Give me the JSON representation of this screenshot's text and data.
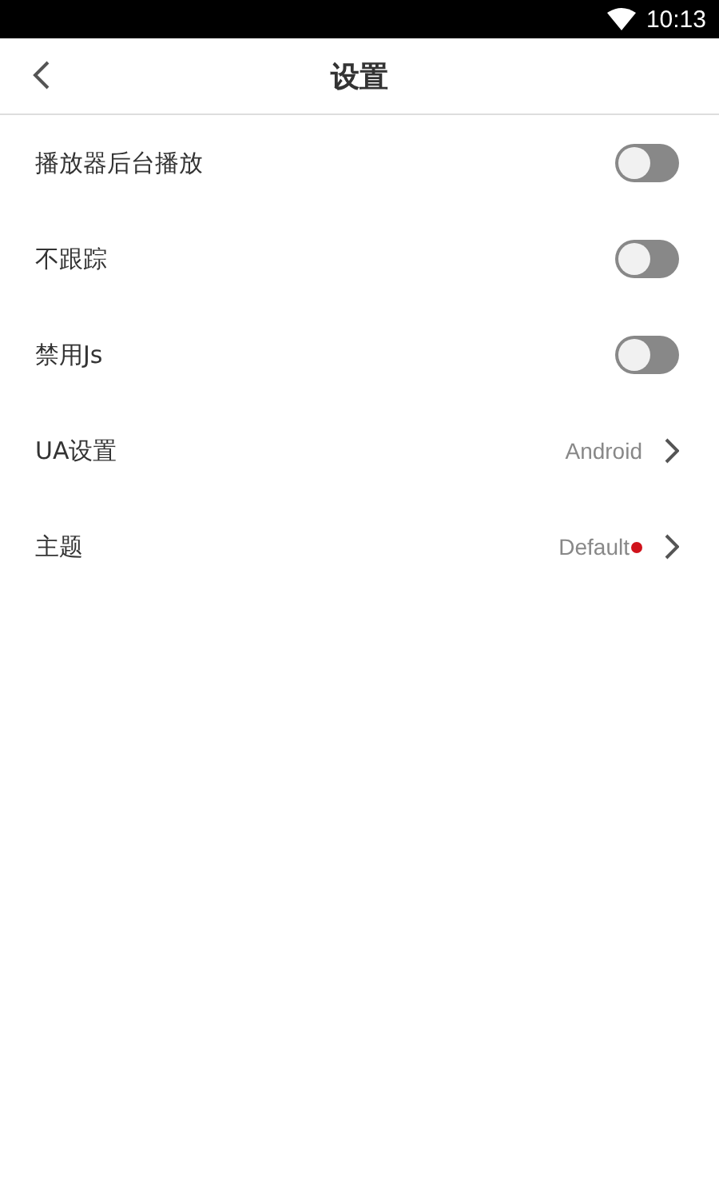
{
  "status_bar": {
    "time": "10:13"
  },
  "header": {
    "title": "设置"
  },
  "settings": [
    {
      "kind": "toggle",
      "label": "播放器后台播放",
      "on": false
    },
    {
      "kind": "toggle",
      "label": "不跟踪",
      "on": false
    },
    {
      "kind": "toggle",
      "label": "禁用Js",
      "on": false
    },
    {
      "kind": "link",
      "label": "UA设置",
      "value": "Android"
    },
    {
      "kind": "link",
      "label": "主题",
      "value": "Default",
      "color": "#d0121b"
    }
  ]
}
